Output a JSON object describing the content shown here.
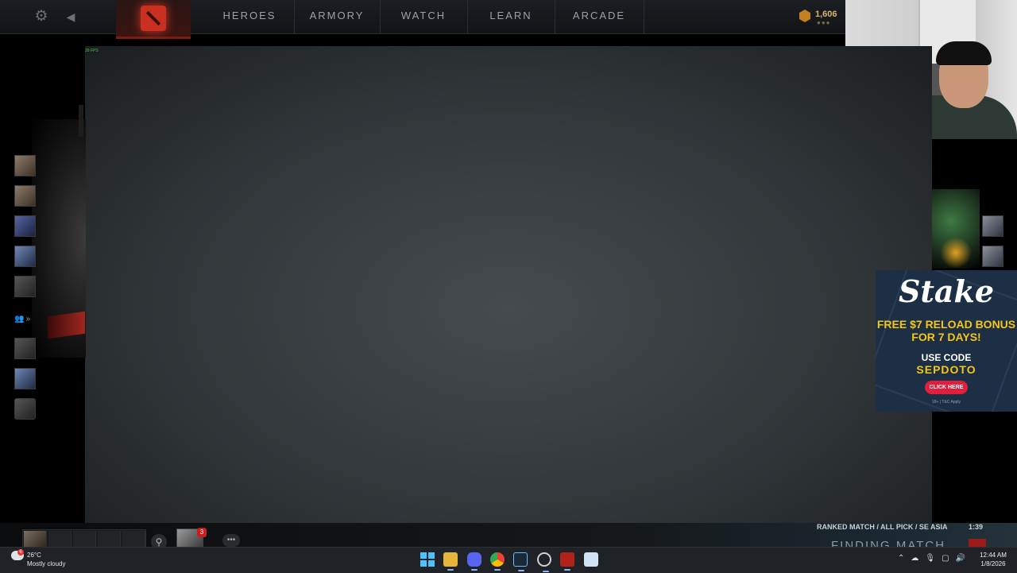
{
  "topbar": {
    "settings_icon": "gear-icon",
    "back_icon": "back-arrow-icon",
    "logo_icon": "dota-logo-icon",
    "nav": [
      {
        "label": "HEROES"
      },
      {
        "label": "ARMORY"
      },
      {
        "label": "WATCH"
      },
      {
        "label": "LEARN"
      },
      {
        "label": "ARCADE"
      }
    ],
    "currency": {
      "value": "1,606",
      "icon": "shards-icon"
    }
  },
  "main": {
    "fps": "39 FPS"
  },
  "sidebar": {
    "party_glyph": "👥",
    "party_arrow": "»"
  },
  "ad": {
    "brand": "Stake",
    "offer": "FREE $7 RELOAD BONUS FOR 7 DAYS!",
    "code_label": "USE CODE",
    "code": "SEPDOTO",
    "cta": "CLICK HERE",
    "terms": "18+ | T&C Apply"
  },
  "bottom": {
    "friend_count": "3",
    "match_info": "RANKED MATCH / ALL PICK / SE ASIA",
    "timer": "1:39",
    "status": "FINDING MATCH"
  },
  "taskbar": {
    "weather_alert": "6",
    "temperature": "26°C",
    "weather": "Mostly cloudy",
    "time": "12:44 AM",
    "date": "1/8/2026"
  },
  "colors": {
    "accent_red": "#c9301f",
    "ad_bg": "#1c2f45",
    "ad_gold": "#f5c518",
    "cta_pink": "#e01f3d"
  }
}
